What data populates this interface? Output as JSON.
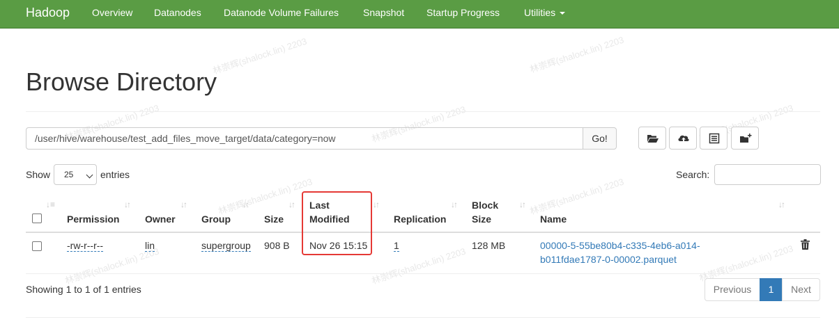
{
  "navbar": {
    "brand": "Hadoop",
    "items": [
      "Overview",
      "Datanodes",
      "Datanode Volume Failures",
      "Snapshot",
      "Startup Progress",
      "Utilities"
    ]
  },
  "watermark": "林崇辉(shalock.lin) 2203",
  "page_title": "Browse Directory",
  "path": {
    "value": "/user/hive/warehouse/test_add_files_move_target/data/category=now",
    "go_label": "Go!"
  },
  "toolbar_icons": [
    "folder-open-icon",
    "cloud-upload-icon",
    "list-icon",
    "folder-plus-icon"
  ],
  "table_controls": {
    "show_label": "Show",
    "page_length": "25",
    "entries_label": "entries",
    "search_label": "Search:",
    "search_value": ""
  },
  "table": {
    "columns": {
      "permission": "Permission",
      "owner": "Owner",
      "group": "Group",
      "size": "Size",
      "last_modified_1": "Last",
      "last_modified_2": "Modified",
      "replication": "Replication",
      "block_size_1": "Block",
      "block_size_2": "Size",
      "name": "Name"
    },
    "rows": [
      {
        "permission": "-rw-r--r--",
        "owner": "lin",
        "group": "supergroup",
        "size": "908 B",
        "last_modified": "Nov 26 15:15",
        "replication": "1",
        "block_size": "128 MB",
        "name_line1": "00000-5-55be80b4-c335-4eb6-a014-",
        "name_line2": "b011fdae1787-0-00002.parquet"
      }
    ]
  },
  "footer": {
    "info": "Showing 1 to 1 of 1 entries",
    "previous": "Previous",
    "current_page": "1",
    "next": "Next"
  },
  "colors": {
    "navbar_bg": "#5a9c44",
    "link": "#337ab7",
    "highlight": "#e53935"
  }
}
